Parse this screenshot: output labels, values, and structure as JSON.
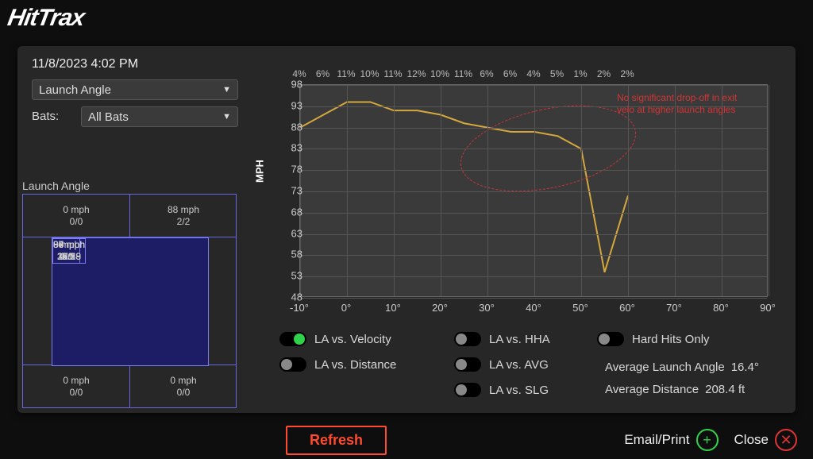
{
  "logo": "HitTrax",
  "timestamp": "11/8/2023 4:02 PM",
  "dropdown_metric": "Launch Angle",
  "bats_label": "Bats:",
  "dropdown_bats": "All Bats",
  "zone_title": "Launch Angle",
  "zone": {
    "top_left": {
      "mph": "0 mph",
      "ratio": "0/0"
    },
    "top_right": {
      "mph": "88 mph",
      "ratio": "2/2"
    },
    "bot_left": {
      "mph": "0 mph",
      "ratio": "0/0"
    },
    "bot_right": {
      "mph": "0 mph",
      "ratio": "0/0"
    },
    "grid": [
      {
        "mph": "0 mph",
        "ratio": "1/1"
      },
      {
        "mph": "89 mph",
        "ratio": "18/19"
      },
      {
        "mph": "90 mph",
        "ratio": "25/28"
      },
      {
        "mph": "0 mph",
        "ratio": "0/0"
      },
      {
        "mph": "88 mph",
        "ratio": "30/33"
      },
      {
        "mph": "88 mph",
        "ratio": "36/39"
      },
      {
        "mph": "87 mph",
        "ratio": "1/1"
      },
      {
        "mph": "86 mph",
        "ratio": "5/5"
      },
      {
        "mph": "94 mph",
        "ratio": "2/3"
      }
    ]
  },
  "chart_data": {
    "type": "line",
    "ylabel": "MPH",
    "xlabel": "",
    "ylim": [
      48,
      98
    ],
    "xlim": [
      -10,
      90
    ],
    "x": [
      -10,
      -5,
      0,
      5,
      10,
      15,
      20,
      25,
      30,
      35,
      40,
      45,
      50,
      55,
      60
    ],
    "y": [
      88,
      91,
      94,
      94,
      92,
      92,
      91,
      89,
      88,
      87,
      87,
      86,
      83,
      54,
      72
    ],
    "x_ticks": [
      "-10°",
      "0°",
      "10°",
      "20°",
      "30°",
      "40°",
      "50°",
      "60°",
      "70°",
      "80°",
      "90°"
    ],
    "y_ticks": [
      48,
      53,
      58,
      63,
      68,
      73,
      78,
      83,
      88,
      93,
      98
    ],
    "top_pct": [
      "4%",
      "6%",
      "11%",
      "10%",
      "11%",
      "12%",
      "10%",
      "11%",
      "6%",
      "6%",
      "4%",
      "5%",
      "1%",
      "2%",
      "2%"
    ],
    "annotation": "No significant drop-off in exit velo at higher launch angles"
  },
  "toggles": {
    "la_velocity": "LA vs. Velocity",
    "la_distance": "LA vs. Distance",
    "la_hha": "LA vs. HHA",
    "la_avg": "LA vs. AVG",
    "la_slg": "LA vs. SLG",
    "hard_hits": "Hard Hits Only"
  },
  "stats": {
    "avg_la_label": "Average Launch Angle",
    "avg_la_value": "16.4°",
    "avg_dist_label": "Average Distance",
    "avg_dist_value": "208.4 ft"
  },
  "buttons": {
    "refresh": "Refresh",
    "email": "Email/Print",
    "close": "Close"
  }
}
